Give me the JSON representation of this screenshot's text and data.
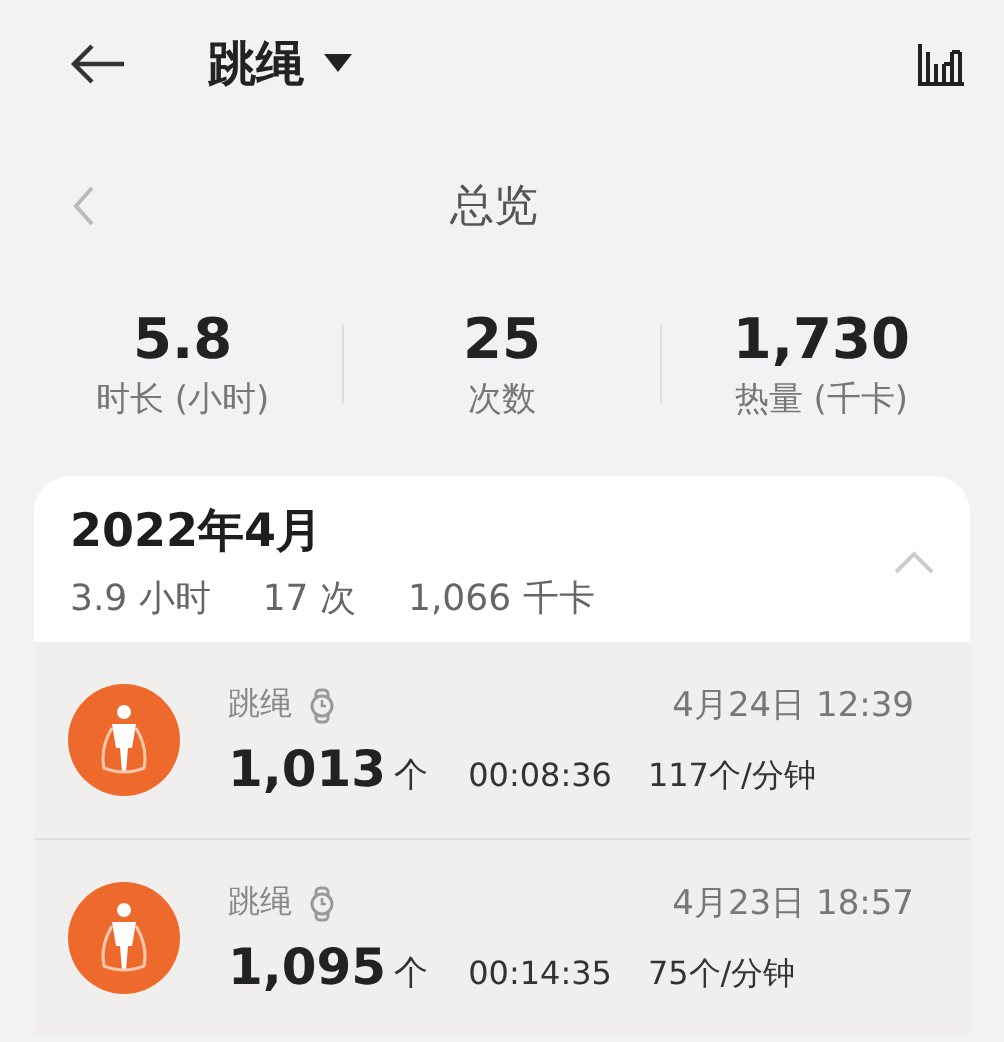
{
  "header": {
    "title": "跳绳"
  },
  "overview": {
    "title": "总览"
  },
  "stats": [
    {
      "value": "5.8",
      "label": "时长 (小时)"
    },
    {
      "value": "25",
      "label": "次数"
    },
    {
      "value": "1,730",
      "label": "热量 (千卡)"
    }
  ],
  "month": {
    "title": "2022年4月",
    "summary": [
      "3.9 小时",
      "17 次",
      "1,066 千卡"
    ],
    "expanded": true,
    "records": [
      {
        "name": "跳绳",
        "datetime": "4月24日 12:39",
        "count": "1,013",
        "unit": "个",
        "duration": "00:08:36",
        "rate": "117个/分钟"
      },
      {
        "name": "跳绳",
        "datetime": "4月23日 18:57",
        "count": "1,095",
        "unit": "个",
        "duration": "00:14:35",
        "rate": "75个/分钟"
      }
    ]
  }
}
